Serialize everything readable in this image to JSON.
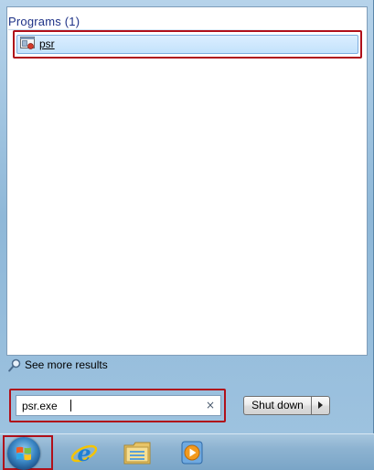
{
  "results": {
    "header": "Programs (1)",
    "items": [
      {
        "label": "psr",
        "icon": "steps-recorder-icon"
      }
    ]
  },
  "see_more": {
    "label": "See more results",
    "icon": "search-icon"
  },
  "search": {
    "value": "psr.exe",
    "clear_icon": "×"
  },
  "shutdown": {
    "label": "Shut down",
    "arrow_icon": "arrow-right-icon"
  },
  "taskbar": {
    "items": [
      {
        "icon": "start-orb-icon"
      },
      {
        "icon": "internet-explorer-icon"
      },
      {
        "icon": "windows-explorer-icon"
      },
      {
        "icon": "media-player-icon"
      }
    ]
  },
  "colors": {
    "highlight_red": "#b0101a",
    "header_blue": "#1e3287",
    "selection_blue": "#c3e2fb"
  }
}
